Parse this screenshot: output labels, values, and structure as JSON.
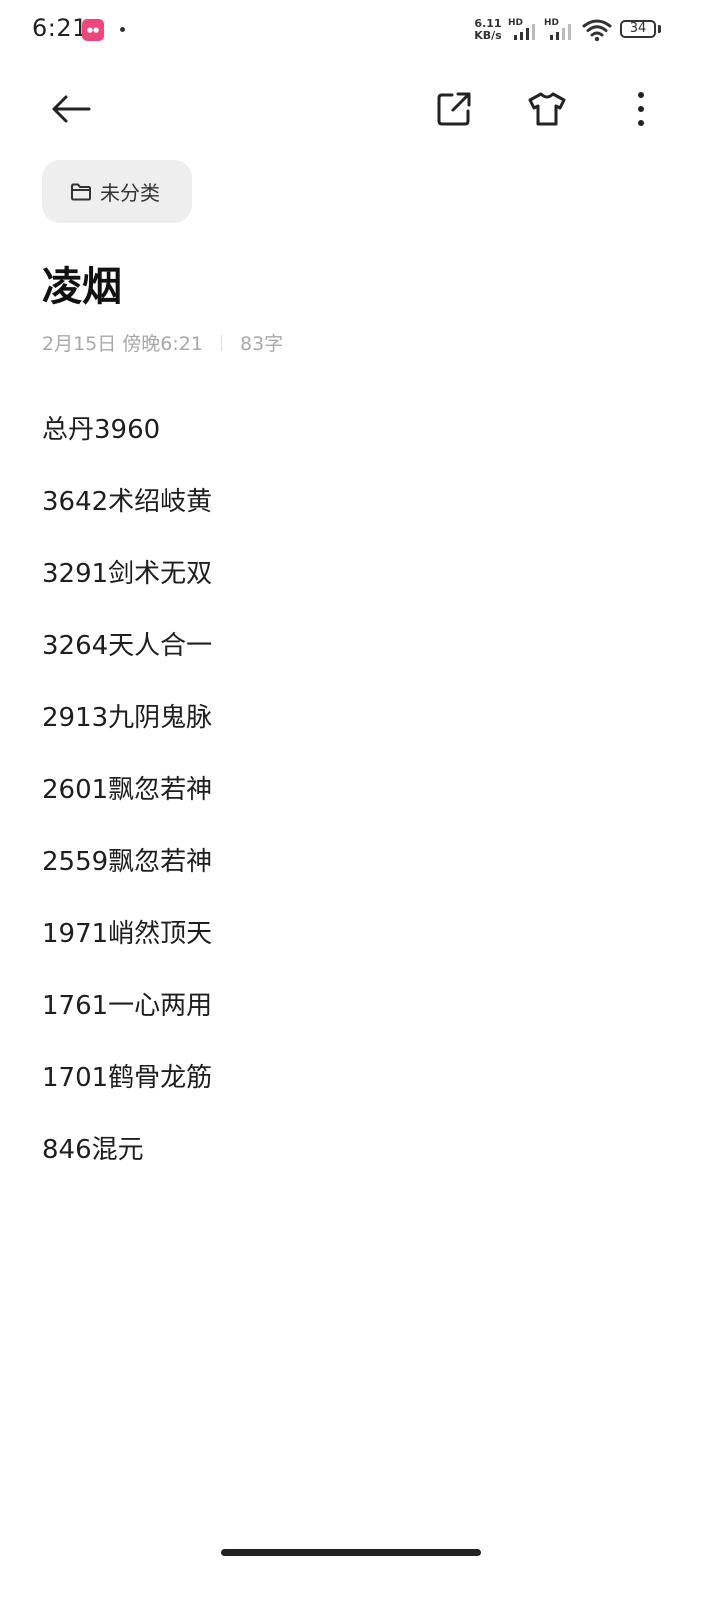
{
  "status_bar": {
    "time": "6:21",
    "app_notification_icon": "app-notification-icon",
    "net_speed_value": "6.11",
    "net_speed_unit": "KB/s",
    "sim1_label": "HD",
    "sim2_label": "HD",
    "battery": "34"
  },
  "toolbar": {
    "back_icon": "back-arrow-icon",
    "share_icon": "share-export-icon",
    "theme_icon": "shirt-theme-icon",
    "more_icon": "more-vertical-icon"
  },
  "note": {
    "folder_label": "未分类",
    "title": "凌烟",
    "date": "2月15日 傍晚6:21",
    "word_count": "83字",
    "lines": [
      "总丹3960",
      "3642术绍岐黄",
      "3291剑术无双",
      "3264天人合一",
      "2913九阴鬼脉",
      "2601飘忽若神",
      "2559飘忽若神",
      "1971峭然顶天",
      "1761一心两用",
      "1701鹤骨龙筋",
      "846混元"
    ]
  }
}
